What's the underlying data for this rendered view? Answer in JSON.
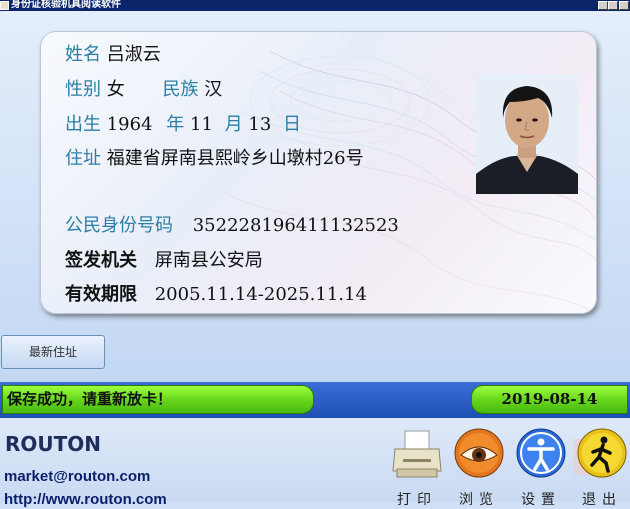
{
  "window": {
    "title": "身份证核验机具阅读软件"
  },
  "card": {
    "name_label": "姓名",
    "name": "吕淑云",
    "sex_label": "性别",
    "sex": "女",
    "ethnic_label": "民族",
    "ethnic": "汉",
    "birth_label": "出生",
    "birth_year": "1964",
    "year_label": "年",
    "birth_month": "11",
    "month_label": "月",
    "birth_day": "13",
    "day_label": "日",
    "address_label": "住址",
    "address": "福建省屏南县熙岭乡山墩村26号",
    "id_label": "公民身份号码",
    "id_number": "352228196411132523",
    "authority_label": "签发机关",
    "authority": "屏南县公安局",
    "validity_label": "有效期限",
    "validity": "2005.11.14-2025.11.14"
  },
  "buttons": {
    "latest_address": "最新住址"
  },
  "status": {
    "message": "保存成功，请重新放卡！",
    "date": "2019-08-14"
  },
  "footer": {
    "logo": "ROUTON",
    "email": "market@routon.com",
    "url": "http://www.routon.com"
  },
  "toolbar": [
    {
      "name": "print",
      "label": "打印",
      "icon": "printer-icon"
    },
    {
      "name": "browse",
      "label": "浏览",
      "icon": "eye-icon"
    },
    {
      "name": "settings",
      "label": "设置",
      "icon": "accessibility-icon"
    },
    {
      "name": "exit",
      "label": "退出",
      "icon": "exit-icon"
    }
  ],
  "colors": {
    "label": "#2a7fa6",
    "status_green": "#63d31b",
    "band_blue": "#1e4fb3",
    "title_bar": "#0a246a"
  }
}
